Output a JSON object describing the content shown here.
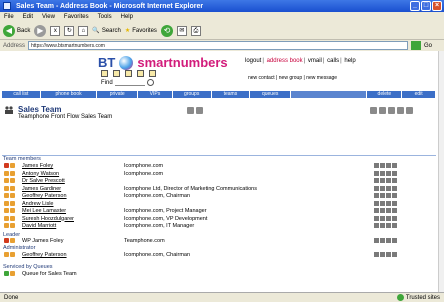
{
  "window": {
    "title": "Sales Team - Address Book - Microsoft Internet Explorer",
    "controls": [
      "_",
      "□",
      "×"
    ]
  },
  "menu": [
    "File",
    "Edit",
    "View",
    "Favorites",
    "Tools",
    "Help"
  ],
  "toolbar": {
    "back_label": "Back",
    "search_label": "Search",
    "favorites_label": "Favorites"
  },
  "address": {
    "label": "Address",
    "url": "https://www.btsmartnumbers.com",
    "go_label": "Go"
  },
  "brand": {
    "bt": "BT",
    "smartnumbers": "smartnumbers",
    "bt_color": "#2a4fa8",
    "sn_color": "#d21c7b"
  },
  "topnav": {
    "logout": "logout",
    "address_book": "address book",
    "vmail": "vmail",
    "calls": "calls",
    "help": "help"
  },
  "subnav": {
    "new_contact": "new contact",
    "new_group": "new group",
    "new_message": "new message"
  },
  "find_label": "Find",
  "tabs": [
    "call list",
    "phone book",
    "private",
    "VIPs",
    "groups",
    "teams",
    "queues",
    "delete",
    "edit"
  ],
  "team": {
    "name": "Sales Team",
    "description": "Teamphone Front Flow Sales Team"
  },
  "members_label": "Team members",
  "members": [
    {
      "name": "James Foley",
      "org": "Icomphone.com",
      "wp": true
    },
    {
      "name": "Antony Watson",
      "org": "Icomphone.com",
      "wp": false
    },
    {
      "name": "Dr Salve Prescott",
      "org": "",
      "wp": false
    },
    {
      "name": "James Gardiner",
      "org": "Icomphone Ltd, Director of Marketing Communications",
      "wp": false
    },
    {
      "name": "Geoffrey Paterson",
      "org": "Icomphone.com, Chairman",
      "wp": false
    },
    {
      "name": "Andrew Lisle",
      "org": "",
      "wp": false
    },
    {
      "name": "Mei Lee Lamaster",
      "org": "Icomphone.com, Project Manager",
      "wp": false
    },
    {
      "name": "Suresh Hoozdulgarer",
      "org": "Icomphone.com, VP Development",
      "wp": false
    },
    {
      "name": "David Marriott",
      "org": "Icomphone.com, IT Manager",
      "wp": false
    }
  ],
  "leader_label": "Leader",
  "leader": {
    "name": "WP James Foley",
    "org": "Teamphone.com"
  },
  "admin_label": "Administrator",
  "admin": {
    "name": "Geoffrey Paterson",
    "org": "Icomphone.com, Chairman"
  },
  "queues_label": "Serviced by Queues",
  "queue": {
    "name": "Queue for Sales Team"
  },
  "status": {
    "text": "Done",
    "zone": "Trusted sites"
  },
  "colors": {
    "tab_bg": "#3c6fc7",
    "heading": "#203a78",
    "accent_pink": "#d21c7b"
  }
}
